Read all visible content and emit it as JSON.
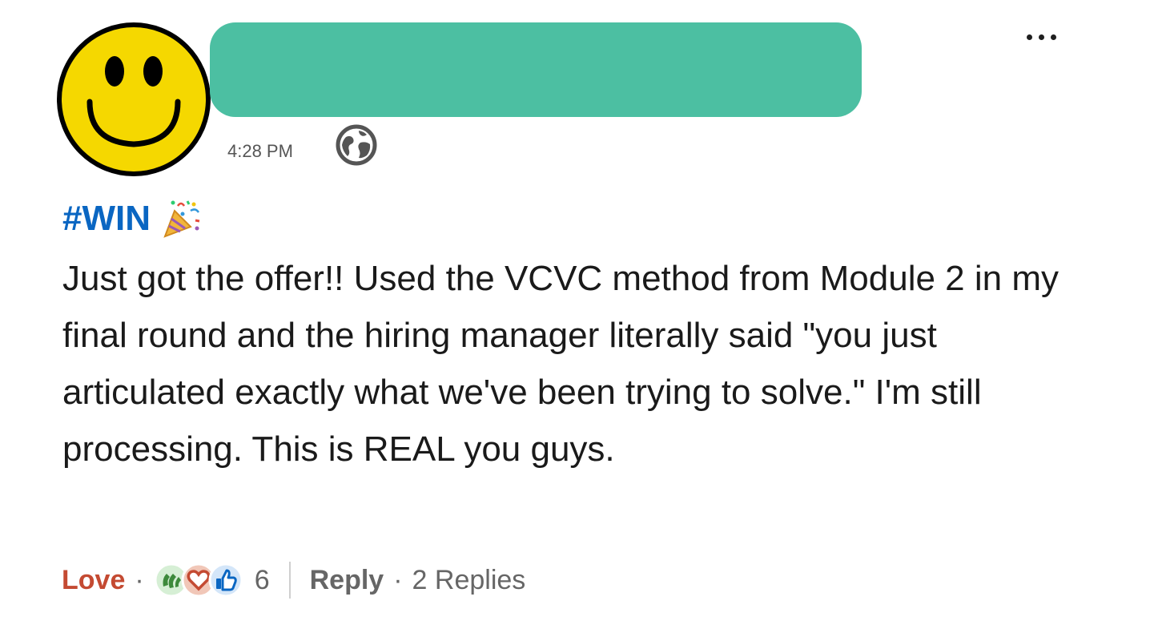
{
  "comment": {
    "author_avatar": "smiley-face-avatar",
    "name_redaction_color": "#4cbfa2",
    "more_options": "more-options-icon",
    "timestamp": "4:28 PM",
    "visibility": "globe-icon",
    "hashtag": "#WIN",
    "hashtag_emoji": "party-popper-icon",
    "body": "Just got the offer!! Used the VCVC method from Module 2 in my final round and the hiring manager literally said \"you just articulated exactly what we've been trying to solve.\" I'm still processing. This is REAL you guys."
  },
  "footer": {
    "reaction_label": "Love",
    "dot_1": "·",
    "reaction_icons": [
      "celebrate-icon",
      "love-icon",
      "like-icon"
    ],
    "reaction_count": "6",
    "reply_label": "Reply",
    "dot_2": "·",
    "replies_link": "2 Replies"
  },
  "colors": {
    "hashtag": "#0a66c2",
    "love": "#c44a32",
    "avatar_face": "#f5d800",
    "text_primary": "#1a1a1a",
    "text_secondary": "#666666"
  }
}
